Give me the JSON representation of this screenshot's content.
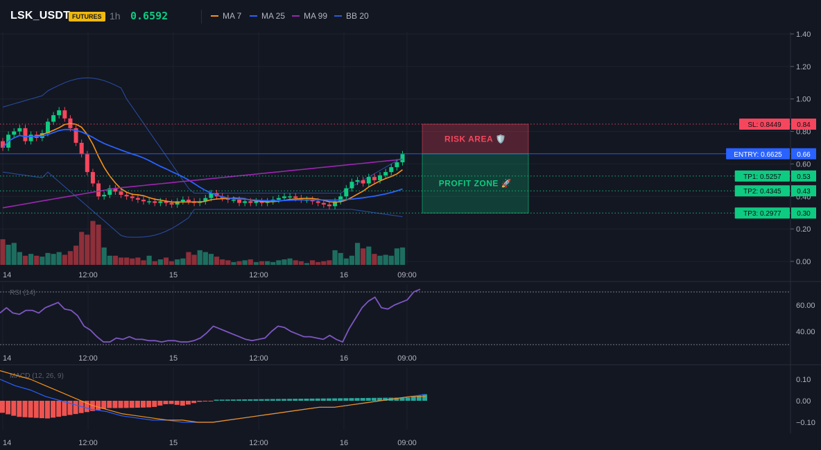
{
  "header": {
    "symbol": "LSK_USDT",
    "badge": "FUTURES",
    "timeframe": "1h",
    "price": "0.6592",
    "legend": [
      {
        "label": "MA 7",
        "color": "#f7931a"
      },
      {
        "label": "MA 25",
        "color": "#2962ff"
      },
      {
        "label": "MA 99",
        "color": "#9c27b0"
      },
      {
        "label": "BB 20",
        "color": "#2a5cd6"
      }
    ]
  },
  "colors": {
    "up": "#0ecb81",
    "down": "#f6465d",
    "volUp": "#1e6e60",
    "volDown": "#8e2f3a",
    "ma7": "#f7931a",
    "ma25": "#2962ff",
    "ma99": "#9c27b0",
    "bb": "#2a4fa8",
    "rsi": "#7e57c2",
    "macd": "#2962ff",
    "signal": "#f7931a",
    "histUp": "#26a69a",
    "histDown": "#ef5350"
  },
  "xlabels": [
    "14",
    "12:00",
    "15",
    "12:00",
    "16",
    "09:00"
  ],
  "panels": {
    "rsi_title": "RSI (14)",
    "macd_title": "MACD (12, 26, 9)"
  },
  "zones": {
    "risk": "RISK AREA 🛡️",
    "profit": "PROFIT ZONE 🚀"
  },
  "chart_data": {
    "type": "candlestick",
    "price_axis": {
      "ticks": [
        "1.40",
        "1.20",
        "1.00",
        "0.80",
        "0.60",
        "0.40",
        "0.20",
        "0.00"
      ],
      "ylim": [
        0,
        1.4
      ]
    },
    "rsi_axis": {
      "ticks": [
        "60.00",
        "40.00"
      ],
      "levels": [
        70,
        30
      ]
    },
    "macd_axis": {
      "ticks": [
        "0.10",
        "0.00",
        "−0.10"
      ]
    },
    "levels": [
      {
        "label": "SL: 0.8449",
        "short": "0.84",
        "value": 0.8449,
        "color": "#f6465d",
        "style": "dotted"
      },
      {
        "label": "ENTRY: 0.6625",
        "short": "0.66",
        "value": 0.6625,
        "color": "#2962ff",
        "style": "solid"
      },
      {
        "label": "TP1: 0.5257",
        "short": "0.53",
        "value": 0.5257,
        "color": "#0ecb81",
        "style": "dotted"
      },
      {
        "label": "TP2: 0.4345",
        "short": "0.43",
        "value": 0.4345,
        "color": "#0ecb81",
        "style": "dotted"
      },
      {
        "label": "TP3: 0.2977",
        "short": "0.30",
        "value": 0.2977,
        "color": "#0ecb81",
        "style": "dotted"
      }
    ],
    "closes": [
      0.7,
      0.78,
      0.8,
      0.82,
      0.74,
      0.78,
      0.76,
      0.79,
      0.86,
      0.9,
      0.93,
      0.88,
      0.82,
      0.73,
      0.66,
      0.55,
      0.48,
      0.4,
      0.41,
      0.45,
      0.43,
      0.41,
      0.4,
      0.39,
      0.38,
      0.37,
      0.37,
      0.36,
      0.37,
      0.36,
      0.35,
      0.37,
      0.38,
      0.37,
      0.36,
      0.37,
      0.39,
      0.42,
      0.4,
      0.39,
      0.38,
      0.38,
      0.36,
      0.37,
      0.36,
      0.37,
      0.36,
      0.37,
      0.38,
      0.39,
      0.4,
      0.4,
      0.39,
      0.38,
      0.38,
      0.37,
      0.36,
      0.35,
      0.34,
      0.37,
      0.4,
      0.45,
      0.49,
      0.5,
      0.48,
      0.52,
      0.5,
      0.53,
      0.55,
      0.58,
      0.61,
      0.66
    ],
    "volume": [
      0.28,
      0.22,
      0.24,
      0.14,
      0.1,
      0.12,
      0.1,
      0.09,
      0.13,
      0.12,
      0.14,
      0.11,
      0.15,
      0.21,
      0.36,
      0.33,
      0.48,
      0.44,
      0.19,
      0.1,
      0.1,
      0.08,
      0.08,
      0.07,
      0.08,
      0.05,
      0.1,
      0.04,
      0.06,
      0.08,
      0.04,
      0.06,
      0.07,
      0.14,
      0.11,
      0.16,
      0.14,
      0.12,
      0.09,
      0.06,
      0.05,
      0.03,
      0.04,
      0.05,
      0.06,
      0.03,
      0.04,
      0.04,
      0.03,
      0.05,
      0.06,
      0.07,
      0.05,
      0.04,
      0.02,
      0.05,
      0.03,
      0.04,
      0.05,
      0.16,
      0.13,
      0.07,
      0.1,
      0.24,
      0.18,
      0.2,
      0.12,
      0.1,
      0.11,
      0.1,
      0.18,
      0.19
    ],
    "rsi": [
      54,
      58,
      54,
      53,
      56,
      56,
      54,
      58,
      60,
      62,
      57,
      56,
      52,
      44,
      41,
      36,
      32,
      32,
      35,
      34,
      36,
      34,
      34,
      33,
      33,
      32,
      33,
      33,
      32,
      32,
      33,
      35,
      39,
      44,
      42,
      40,
      38,
      36,
      34,
      33,
      34,
      35,
      40,
      44,
      43,
      40,
      38,
      36,
      36,
      35,
      34,
      37,
      34,
      32,
      42,
      50,
      58,
      63,
      66,
      58,
      57,
      60,
      62,
      64,
      70,
      72
    ],
    "macd": [
      0.1,
      0.07,
      0.05,
      0.02,
      0.0,
      -0.02,
      -0.04,
      -0.05,
      -0.07,
      -0.08,
      -0.09,
      -0.09,
      -0.1,
      -0.1,
      -0.1,
      -0.09,
      -0.08,
      -0.07,
      -0.06,
      -0.05,
      -0.04,
      -0.03,
      -0.03,
      -0.02,
      -0.01,
      0.0,
      0.01,
      0.02,
      0.03
    ],
    "signal": [
      0.14,
      0.12,
      0.1,
      0.07,
      0.04,
      0.01,
      -0.02,
      -0.04,
      -0.06,
      -0.07,
      -0.08,
      -0.09,
      -0.09,
      -0.1,
      -0.1,
      -0.09,
      -0.08,
      -0.07,
      -0.06,
      -0.05,
      -0.04,
      -0.03,
      -0.03,
      -0.02,
      -0.01,
      0.0,
      0.01,
      0.02,
      0.02
    ]
  }
}
